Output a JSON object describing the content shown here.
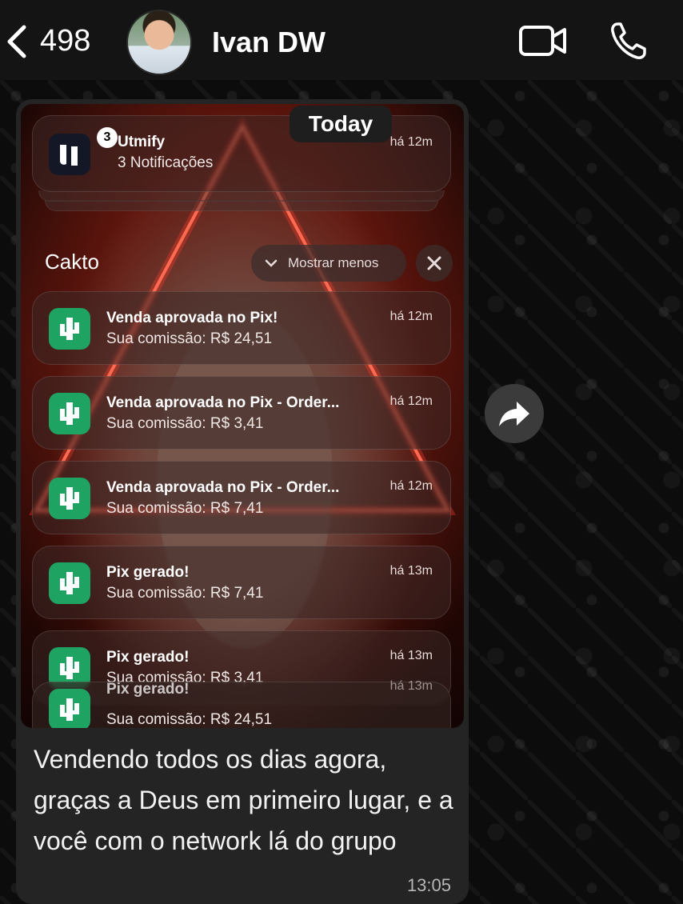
{
  "header": {
    "back_count": "498",
    "contact_name": "Ivan DW"
  },
  "date_divider": "Today",
  "screenshot": {
    "utmify": {
      "app_name": "Utmify",
      "summary": "3 Notificações",
      "badge_count": "3",
      "time": "há 12m"
    },
    "group": {
      "title": "Cakto",
      "show_less_label": "Mostrar menos"
    },
    "notifications": [
      {
        "title": "Venda aprovada no Pix!",
        "body": "Sua comissão: R$ 24,51",
        "time": "há 12m"
      },
      {
        "title": "Venda aprovada no Pix - Order...",
        "body": "Sua comissão: R$ 3,41",
        "time": "há 12m"
      },
      {
        "title": "Venda aprovada no Pix - Order...",
        "body": "Sua comissão: R$ 7,41",
        "time": "há 12m"
      },
      {
        "title": "Pix gerado!",
        "body": "Sua comissão: R$ 7,41",
        "time": "há 13m"
      },
      {
        "title": "Pix gerado!",
        "body": "Sua comissão: R$ 3,41",
        "time": "há 13m"
      },
      {
        "title": "Pix gerado!",
        "body": "Sua comissão: R$ 24,51",
        "time": "há 13m"
      }
    ]
  },
  "message": {
    "text": "Vendendo todos os dias agora, graças a Deus em primeiro lugar, e a você com o network lá do grupo",
    "time": "13:05"
  },
  "icons": {
    "back": "chevron-left-icon",
    "video": "video-camera-icon",
    "phone": "phone-icon",
    "forward": "forward-icon",
    "cakto": "cactus-icon",
    "utmify": "utmify-logo-icon"
  },
  "colors": {
    "header_bg": "#141414",
    "bubble_bg": "#242424",
    "cakto_green": "#1fa363"
  }
}
